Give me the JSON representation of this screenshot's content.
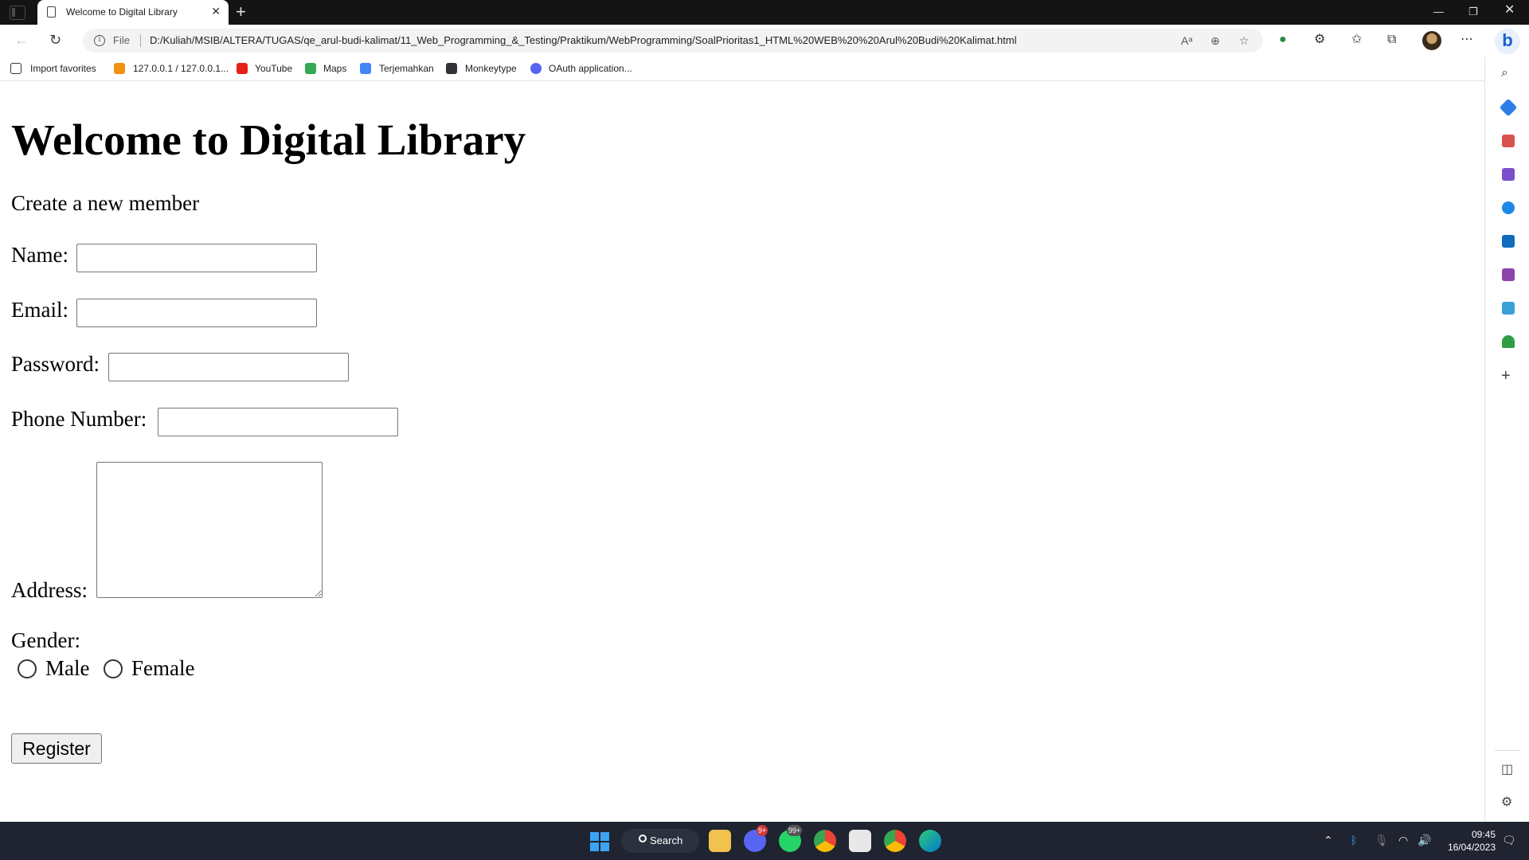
{
  "browser": {
    "tab_title": "Welcome to Digital Library",
    "address": {
      "scheme_label": "File",
      "url": "D:/Kuliah/MSIB/ALTERA/TUGAS/qe_arul-budi-kalimat/11_Web_Programming_&_Testing/Praktikum/WebProgramming/SoalPrioritas1_HTML%20WEB%20%20Arul%20Budi%20Kalimat.html"
    },
    "bookmarks": [
      {
        "label": "Import favorites",
        "icon": "import-icon"
      },
      {
        "label": "127.0.0.1 / 127.0.0.1...",
        "icon": "phpmyadmin-icon"
      },
      {
        "label": "YouTube",
        "icon": "youtube-icon"
      },
      {
        "label": "Maps",
        "icon": "maps-icon"
      },
      {
        "label": "Terjemahkan",
        "icon": "translate-icon"
      },
      {
        "label": "Monkeytype",
        "icon": "monkeytype-icon"
      },
      {
        "label": "OAuth application...",
        "icon": "discord-icon"
      }
    ]
  },
  "page": {
    "heading": "Welcome to Digital Library",
    "subtitle": "Create a new member",
    "form": {
      "name_label": "Name:",
      "name_value": "",
      "email_label": "Email:",
      "email_value": "",
      "password_label": "Password:",
      "password_value": "",
      "phone_label": "Phone Number:",
      "phone_value": "",
      "address_label": "Address:",
      "address_value": "",
      "gender_label": "Gender:",
      "gender_options": [
        "Male",
        "Female"
      ],
      "gender_selected": null,
      "submit_label": "Register"
    }
  },
  "taskbar": {
    "search_label": "Search",
    "discord_badge": "9+",
    "whatsapp_badge": "99+",
    "time": "09:45",
    "date": "16/04/2023"
  },
  "colors": {
    "titlebar": "#141414",
    "taskbar": "#1f2430",
    "accent_blue": "#3ca4f5"
  }
}
